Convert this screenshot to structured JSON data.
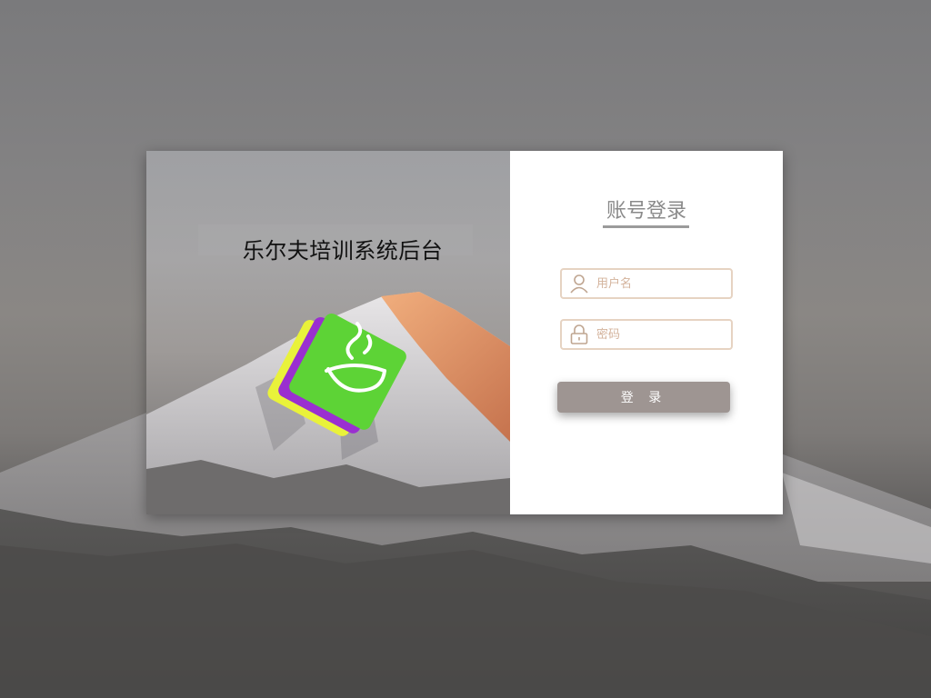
{
  "app": {
    "title": "乐尔夫培训系统后台"
  },
  "login": {
    "heading": "账号登录",
    "username_placeholder": "用户名",
    "username_value": "",
    "password_placeholder": "密码",
    "password_value": "",
    "submit_label": "登 录"
  },
  "icons": {
    "username": "user-icon",
    "password": "lock-icon",
    "logo": "app-logo"
  },
  "colors": {
    "field_border": "#e6d3c2",
    "placeholder": "#d4b39c",
    "button_bg": "#9e9592",
    "heading": "#8a8a8a",
    "logo_green": "#5dd336",
    "logo_purple": "#9a2fd0",
    "logo_yellow": "#e9f23a"
  }
}
